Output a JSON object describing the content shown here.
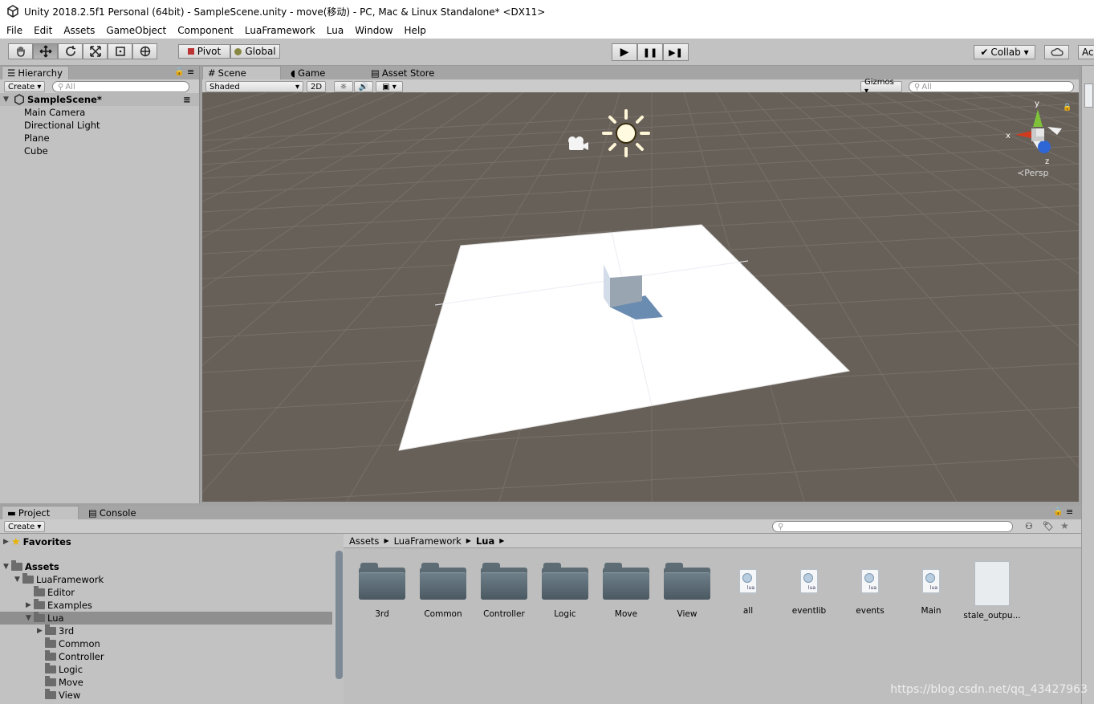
{
  "window": {
    "title": "Unity 2018.2.5f1 Personal (64bit) - SampleScene.unity - move(移动) - PC, Mac & Linux Standalone* <DX11>"
  },
  "menu": [
    "File",
    "Edit",
    "Assets",
    "GameObject",
    "Component",
    "LuaFramework",
    "Lua",
    "Window",
    "Help"
  ],
  "toolbar": {
    "tools": [
      "hand-icon",
      "move-icon",
      "rotate-icon",
      "scale-icon",
      "rect-icon",
      "transform-icon"
    ],
    "pivot": "Pivot",
    "global": "Global",
    "play": "▶",
    "pause": "❚❚",
    "step": "▶❚",
    "collab": "Collab ▾",
    "account": "Ac"
  },
  "hierarchy": {
    "tab": "Hierarchy",
    "create": "Create ▾",
    "search": "All",
    "scene": "SampleScene*",
    "items": [
      "Main Camera",
      "Directional Light",
      "Plane",
      "Cube"
    ]
  },
  "scene_panel": {
    "tabs": [
      "Scene",
      "Game",
      "Asset Store"
    ],
    "shading": "Shaded",
    "mode2d": "2D",
    "gizmos": "Gizmos ▾",
    "search": "All",
    "persp": "Persp",
    "axes": {
      "x": "x",
      "y": "y",
      "z": "z"
    }
  },
  "project": {
    "tabs": [
      "Project",
      "Console"
    ],
    "create": "Create ▾",
    "tree": [
      {
        "label": "Favorites",
        "level": 0,
        "bold": true,
        "icon": "star-icon",
        "arrow": "▶"
      },
      {
        "label": "Assets",
        "level": 0,
        "bold": true,
        "icon": "folder-icon",
        "arrow": "▼"
      },
      {
        "label": "LuaFramework",
        "level": 1,
        "icon": "folder-icon",
        "arrow": "▼"
      },
      {
        "label": "Editor",
        "level": 2,
        "icon": "folder-icon",
        "arrow": ""
      },
      {
        "label": "Examples",
        "level": 2,
        "icon": "folder-icon",
        "arrow": "▶"
      },
      {
        "label": "Lua",
        "level": 2,
        "icon": "folder-icon",
        "arrow": "▼",
        "selected": true
      },
      {
        "label": "3rd",
        "level": 3,
        "icon": "folder-icon",
        "arrow": "▶"
      },
      {
        "label": "Common",
        "level": 3,
        "icon": "folder-icon",
        "arrow": ""
      },
      {
        "label": "Controller",
        "level": 3,
        "icon": "folder-icon",
        "arrow": ""
      },
      {
        "label": "Logic",
        "level": 3,
        "icon": "folder-icon",
        "arrow": ""
      },
      {
        "label": "Move",
        "level": 3,
        "icon": "folder-icon",
        "arrow": ""
      },
      {
        "label": "View",
        "level": 3,
        "icon": "folder-icon",
        "arrow": ""
      }
    ],
    "breadcrumb": [
      "Assets",
      "LuaFramework",
      "Lua"
    ],
    "assets": [
      {
        "label": "3rd",
        "kind": "folder"
      },
      {
        "label": "Common",
        "kind": "folder"
      },
      {
        "label": "Controller",
        "kind": "folder"
      },
      {
        "label": "Logic",
        "kind": "folder"
      },
      {
        "label": "Move",
        "kind": "folder"
      },
      {
        "label": "View",
        "kind": "folder"
      },
      {
        "label": "all",
        "kind": "lua"
      },
      {
        "label": "eventlib",
        "kind": "lua"
      },
      {
        "label": "events",
        "kind": "lua"
      },
      {
        "label": "Main",
        "kind": "lua"
      },
      {
        "label": "stale_outpu...",
        "kind": "text"
      }
    ],
    "lua_badge": "lua"
  },
  "watermark": "https://blog.csdn.net/qq_43427963"
}
